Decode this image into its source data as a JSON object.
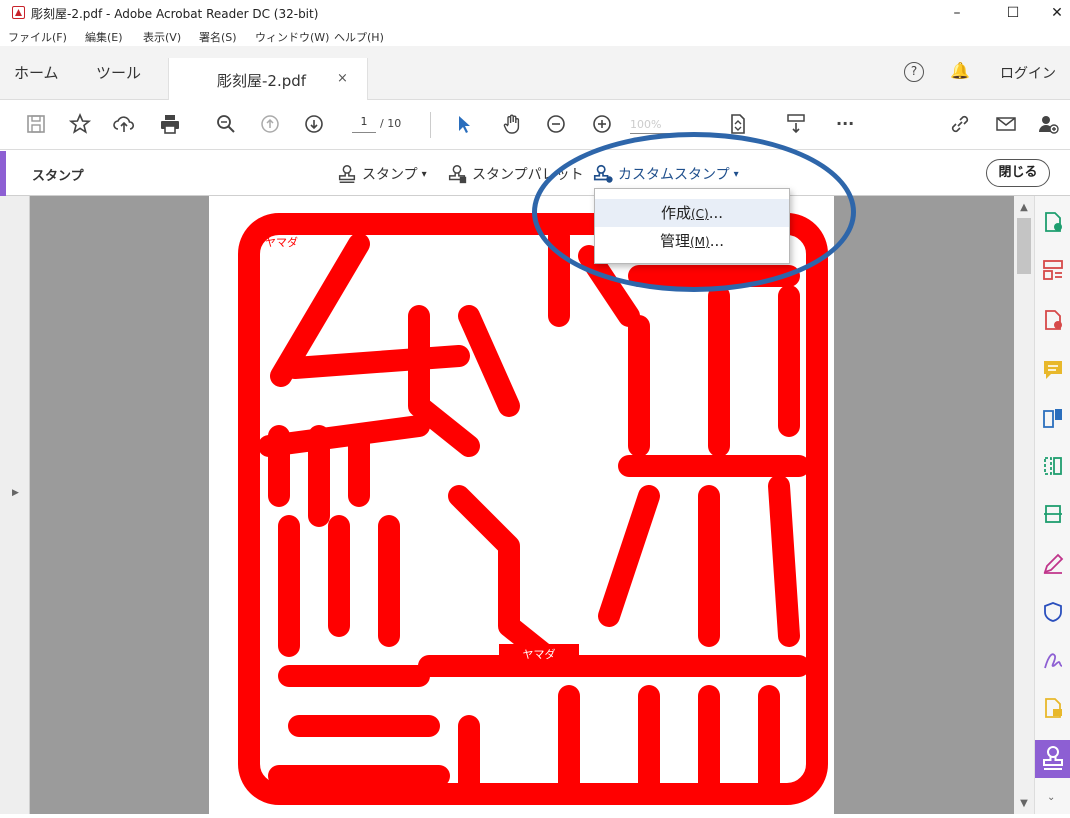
{
  "window": {
    "title": "彫刻屋-2.pdf - Adobe Acrobat Reader DC (32-bit)",
    "minimize": "–",
    "maximize": "☐",
    "close": "✕"
  },
  "menu": [
    "ファイル(F)",
    "編集(E)",
    "表示(V)",
    "署名(S)",
    "ウィンドウ(W)",
    "ヘルプ(H)"
  ],
  "tabs": {
    "home": "ホーム",
    "tools": "ツール",
    "document": "彫刻屋-2.pdf",
    "close_tab": "×",
    "login": "ログイン"
  },
  "toolbar": {
    "page_current": "1",
    "page_total": "/ 10",
    "zoom_value": "100%",
    "more": "···"
  },
  "stamp_bar": {
    "title": "スタンプ",
    "stamp": "スタンプ",
    "stamp_palette": "スタンプパレット",
    "custom_stamp": "カスタムスタンプ",
    "close": "閉じる"
  },
  "dropdown": {
    "items": [
      {
        "label": "作成",
        "accel": "(C)",
        "suffix": "..."
      },
      {
        "label": "管理",
        "accel": "(M)",
        "suffix": "..."
      }
    ]
  },
  "seal": {
    "top_label": "ヤマダ",
    "bottom_label": "ヤマダ",
    "seal_text": "ハンコ",
    "color": "#ff0000"
  },
  "colors": {
    "accent_purple": "#8d5fd3",
    "highlight_blue": "#2e66aa",
    "icon_green": "#1e9e6f",
    "icon_red": "#d64949",
    "icon_yellow": "#e8b82b"
  }
}
